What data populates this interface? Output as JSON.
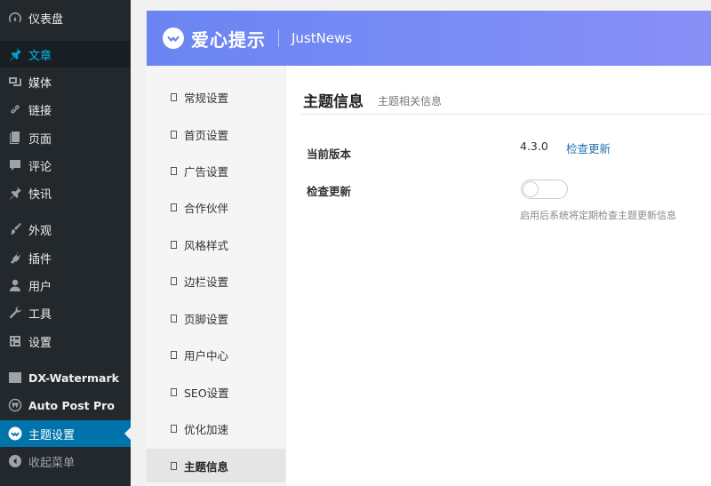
{
  "sidebar": {
    "items": [
      {
        "label": "仪表盘",
        "icon": "dashboard-icon"
      },
      {
        "label": "文章",
        "icon": "pushpin-icon"
      },
      {
        "label": "媒体",
        "icon": "media-icon"
      },
      {
        "label": "链接",
        "icon": "link-icon"
      },
      {
        "label": "页面",
        "icon": "page-icon"
      },
      {
        "label": "评论",
        "icon": "comment-icon"
      },
      {
        "label": "快讯",
        "icon": "pushpin-icon"
      },
      {
        "label": "外观",
        "icon": "paintbrush-icon"
      },
      {
        "label": "插件",
        "icon": "plugin-icon"
      },
      {
        "label": "用户",
        "icon": "user-icon"
      },
      {
        "label": "工具",
        "icon": "wrench-icon"
      },
      {
        "label": "设置",
        "icon": "settings-icon"
      },
      {
        "label": "DX-Watermark",
        "icon": "image-icon"
      },
      {
        "label": "Auto Post Pro",
        "icon": "wordpress-icon"
      },
      {
        "label": "主题设置",
        "icon": "heart-check-icon"
      },
      {
        "label": "收起菜单",
        "icon": "collapse-icon"
      }
    ]
  },
  "panel": {
    "brand": "爱心提示",
    "theme": "JustNews",
    "tabs": [
      "常规设置",
      "首页设置",
      "广告设置",
      "合作伙伴",
      "风格样式",
      "边栏设置",
      "页脚设置",
      "用户中心",
      "SEO设置",
      "优化加速",
      "主题信息"
    ],
    "selected_tab": "主题信息",
    "section": {
      "title": "主题信息",
      "subtitle": "主题相关信息",
      "version_label": "当前版本",
      "version_value": "4.3.0",
      "check_link": "检查更新",
      "update_label": "检查更新",
      "update_toggle_on": false,
      "update_help": "启用后系统将定期检查主题更新信息"
    }
  },
  "colors": {
    "sidebar_bg": "#23282d",
    "active_bg": "#0073aa",
    "header_gradient_start": "#6a85f2",
    "link": "#2271b1"
  }
}
